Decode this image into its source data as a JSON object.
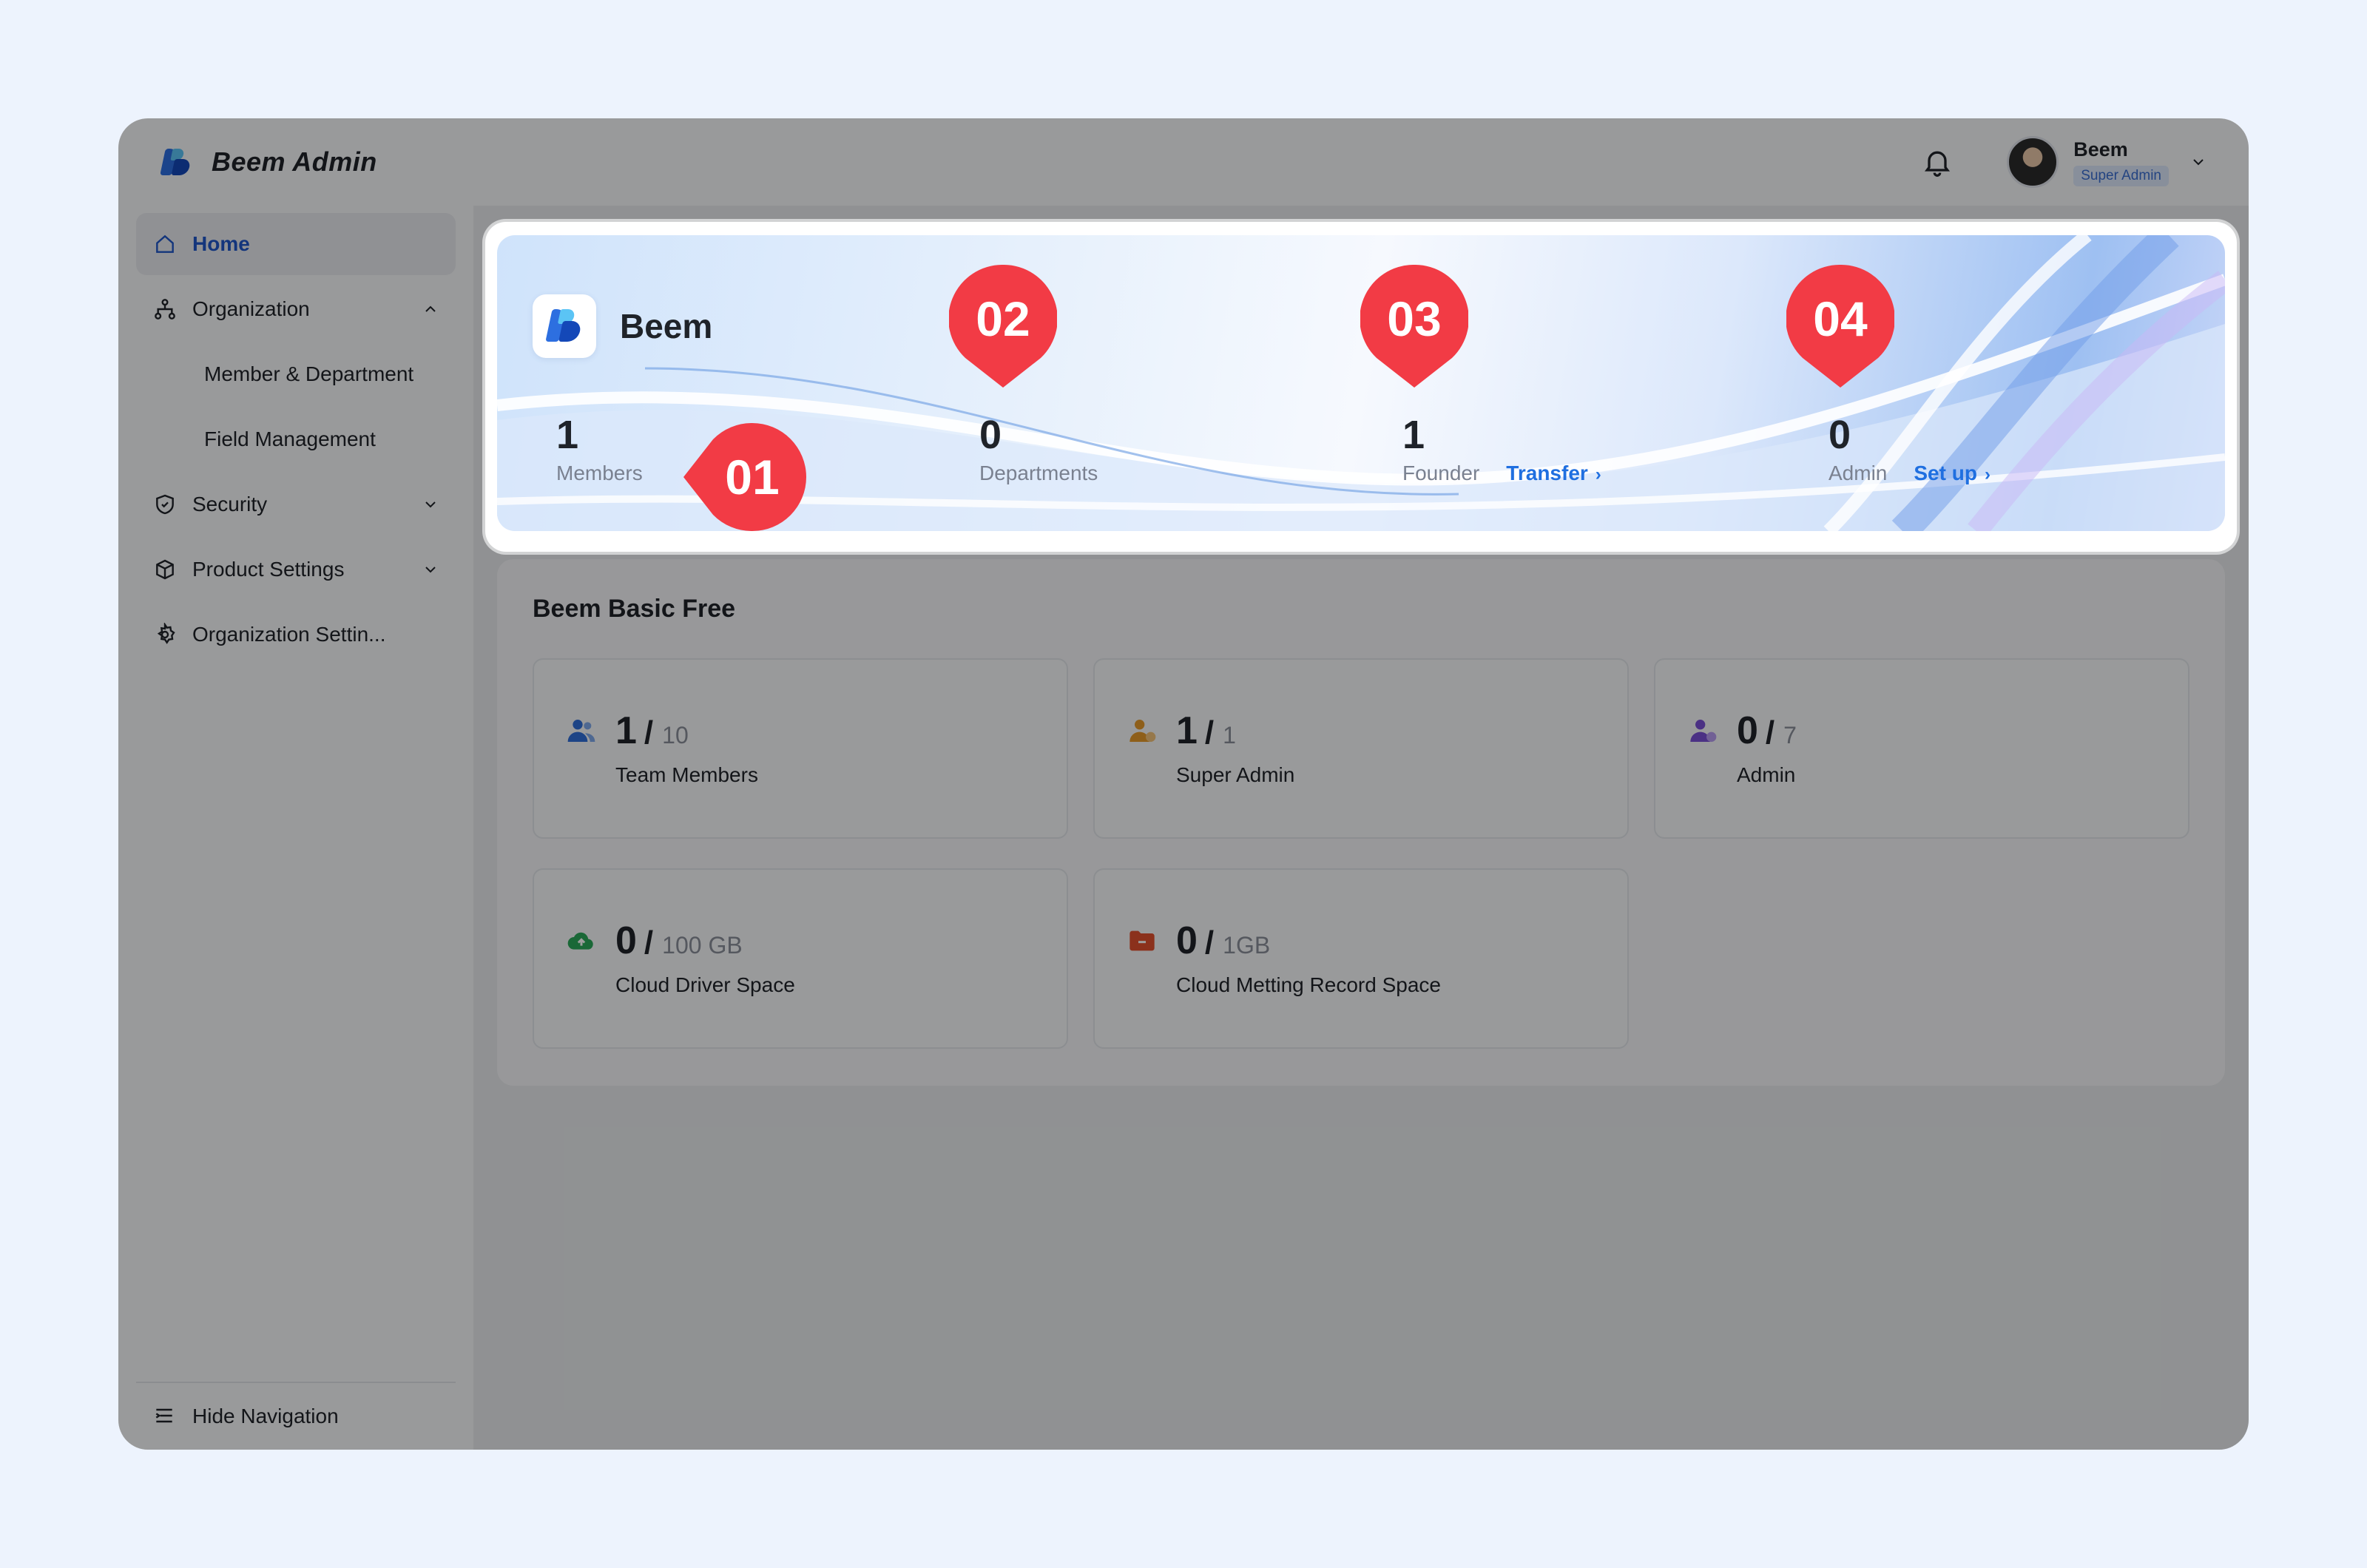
{
  "app": {
    "title": "Beem Admin"
  },
  "user": {
    "name": "Beem",
    "role": "Super Admin"
  },
  "sidebar": {
    "items": [
      {
        "label": "Home",
        "icon": "home-icon",
        "active": true
      },
      {
        "label": "Organization",
        "icon": "organization-icon",
        "expanded": true
      },
      {
        "label": "Member & Department",
        "sub": true
      },
      {
        "label": "Field Management",
        "sub": true
      },
      {
        "label": "Security",
        "icon": "shield-icon"
      },
      {
        "label": "Product Settings",
        "icon": "box-icon"
      },
      {
        "label": "Organization Settin...",
        "icon": "gear-icon"
      }
    ],
    "footer": "Hide Navigation"
  },
  "banner": {
    "brand": "Beem",
    "stats": [
      {
        "value": "1",
        "label": "Members"
      },
      {
        "value": "0",
        "label": "Departments"
      },
      {
        "value": "1",
        "label": "Founder",
        "link": "Transfer"
      },
      {
        "value": "0",
        "label": "Admin",
        "link": "Set up"
      }
    ],
    "markers": [
      "01",
      "02",
      "03",
      "04"
    ]
  },
  "plan": {
    "title": "Beem Basic Free",
    "tiles": [
      {
        "used": "1",
        "total": "10",
        "label": "Team Members",
        "icon": "team-members-icon",
        "color": "#2f6fd8"
      },
      {
        "used": "1",
        "total": "1",
        "label": "Super Admin",
        "icon": "super-admin-icon",
        "color": "#e59a2a"
      },
      {
        "used": "0",
        "total": "7",
        "label": "Admin",
        "icon": "admin-icon",
        "color": "#7a4fd6"
      },
      {
        "used": "0",
        "total": "100 GB",
        "label": "Cloud Driver Space",
        "icon": "cloud-upload-icon",
        "color": "#2aa85a"
      },
      {
        "used": "0",
        "total": "1GB",
        "label": "Cloud Metting Record Space",
        "icon": "folder-icon",
        "color": "#e0502e"
      }
    ]
  },
  "colors": {
    "accent": "#1f6fe0",
    "marker": "#f23b45",
    "overlay": "rgba(0,0,0,0.38)"
  }
}
